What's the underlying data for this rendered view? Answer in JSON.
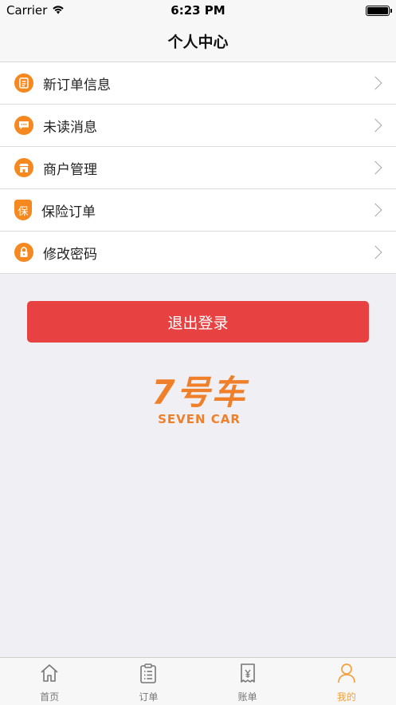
{
  "status_bar": {
    "carrier": "Carrier",
    "time": "6:23 PM"
  },
  "nav": {
    "title": "个人中心"
  },
  "menu": {
    "items": [
      {
        "label": "新订单信息",
        "icon": "document-icon"
      },
      {
        "label": "未读消息",
        "icon": "message-icon"
      },
      {
        "label": "商户管理",
        "icon": "shop-icon"
      },
      {
        "label": "保险订单",
        "icon": "shield-icon",
        "icon_text": "保"
      },
      {
        "label": "修改密码",
        "icon": "lock-icon"
      }
    ]
  },
  "logout": {
    "label": "退出登录"
  },
  "brand": {
    "main": "7号车",
    "sub": "SEVEN CAR"
  },
  "tabs": [
    {
      "label": "首页",
      "icon": "home-icon",
      "active": false
    },
    {
      "label": "订单",
      "icon": "clipboard-icon",
      "active": false
    },
    {
      "label": "账单",
      "icon": "receipt-icon",
      "active": false
    },
    {
      "label": "我的",
      "icon": "person-icon",
      "active": true
    }
  ],
  "colors": {
    "accent": "#f5891f",
    "logout": "#e84141",
    "tab_active": "#f5a03c",
    "brand": "#f07f2a"
  }
}
